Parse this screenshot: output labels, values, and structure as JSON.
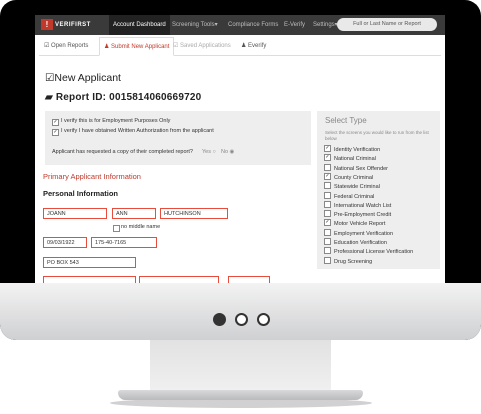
{
  "navbar": {
    "logo_text": "VERIFIRST",
    "logo_glyph": "!",
    "items": [
      "Account Dashboard",
      "Screening Tools▾",
      "Compliance Forms",
      "E-Verify",
      "Settings▾"
    ],
    "search_placeholder": "Full or Last Name or Report"
  },
  "tabs": [
    "Open Reports",
    "Submit New Applicant",
    "Saved Applications",
    "Everify"
  ],
  "page": {
    "title": "New Applicant",
    "report_id": "Report ID: 0015814060669720"
  },
  "verify": {
    "line1": "I verify this is for Employment Purposes Only",
    "line2": "I verify I have obtained Written Authorization from the applicant",
    "copy_question": "Applicant has requested a copy of their completed report?",
    "yes": "Yes",
    "no": "No"
  },
  "select_type": {
    "title": "Select Type",
    "subtitle": "Select the screens you would like to run from the list below",
    "items": [
      {
        "label": "Identity Verification",
        "checked": true
      },
      {
        "label": "National Criminal",
        "checked": true
      },
      {
        "label": "National Sex Offender",
        "checked": false
      },
      {
        "label": "County Criminal",
        "checked": true
      },
      {
        "label": "Statewide Criminal",
        "checked": false
      },
      {
        "label": "Federal Criminal",
        "checked": false
      },
      {
        "label": "International Watch List",
        "checked": false
      },
      {
        "label": "Pre-Employment Credit",
        "checked": false
      },
      {
        "label": "Motor Vehicle Report",
        "checked": true
      },
      {
        "label": "Employment Verification",
        "checked": false
      },
      {
        "label": "Education Verification",
        "checked": false
      },
      {
        "label": "Professional License Verification",
        "checked": false
      },
      {
        "label": "Drug Screening",
        "checked": false
      }
    ]
  },
  "form": {
    "section_title": "Primary Applicant Information",
    "subsection_title": "Personal Information",
    "first_name": "JOANN",
    "middle_name": "ANN",
    "last_name": "HUTCHINSON",
    "no_middle_name": "no middle name",
    "dob": "09/03/1922",
    "ssn": "175-40-7165",
    "address": "PO BOX 543"
  },
  "colors": {
    "accent": "#c0392b",
    "navbar": "#3a3a3a",
    "field_border": "#e74c3c"
  }
}
